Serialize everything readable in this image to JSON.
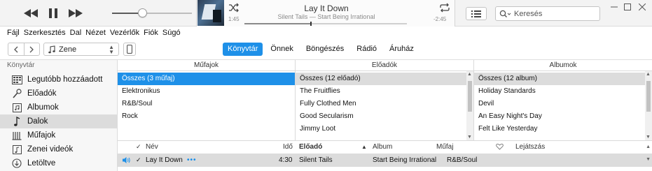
{
  "player": {
    "song_title": "Lay It Down",
    "song_subtitle": "Silent Tails — Start Being Irrational",
    "elapsed": "1:45",
    "remaining": "-2:45",
    "progress": 0.41,
    "volume": 0.38
  },
  "search": {
    "placeholder": "Keresés"
  },
  "menu": [
    "Fájl",
    "Szerkesztés",
    "Dal",
    "Nézet",
    "Vezérlők",
    "Fiók",
    "Súgó"
  ],
  "nav": {
    "media_type": "Zene",
    "tabs": [
      {
        "label": "Könyvtár",
        "active": true
      },
      {
        "label": "Önnek",
        "active": false
      },
      {
        "label": "Böngészés",
        "active": false
      },
      {
        "label": "Rádió",
        "active": false
      },
      {
        "label": "Áruház",
        "active": false
      }
    ]
  },
  "sidebar": {
    "header": "Könyvtár",
    "items": [
      {
        "label": "Legutóbb hozzáadott",
        "icon": "recently-added-icon"
      },
      {
        "label": "Előadók",
        "icon": "microphone-icon"
      },
      {
        "label": "Albumok",
        "icon": "album-icon"
      },
      {
        "label": "Dalok",
        "icon": "music-note-icon",
        "selected": true
      },
      {
        "label": "Műfajok",
        "icon": "genres-icon"
      },
      {
        "label": "Zenei videók",
        "icon": "music-video-icon"
      },
      {
        "label": "Letöltve",
        "icon": "download-icon"
      }
    ]
  },
  "browser": {
    "genres": {
      "header": "Műfajok",
      "rows": [
        "Összes (3 műfaj)",
        "Elektronikus",
        "R&B/Soul",
        "Rock"
      ]
    },
    "artists": {
      "header": "Előadók",
      "rows": [
        "Összes (12 előadó)",
        "The Fruitflies",
        "Fully Clothed Men",
        "Good Secularism",
        "Jimmy Loot"
      ]
    },
    "albums": {
      "header": "Albumok",
      "rows": [
        "Összes (12 album)",
        "Holiday Standards",
        "Devil",
        "An Easy Night's Day",
        "Felt Like Yesterday"
      ]
    }
  },
  "songs": {
    "columns": {
      "name": "Név",
      "time": "Idő",
      "artist": "Előadó",
      "album": "Album",
      "genre": "Műfaj",
      "plays": "Lejátszás"
    },
    "rows": [
      {
        "name": "Lay It Down",
        "more": "•••",
        "time": "4:30",
        "artist": "Silent Tails",
        "album": "Start Being Irrational",
        "genre": "R&B/Soul"
      }
    ]
  },
  "colors": {
    "accent": "#1e90e8",
    "selection_gray": "#dcdcdc"
  }
}
